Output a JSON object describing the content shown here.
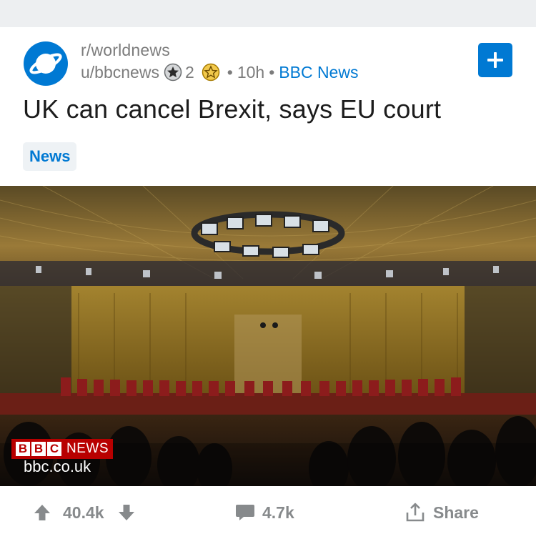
{
  "post": {
    "subreddit": "r/worldnews",
    "author": "u/bbcnews",
    "award_count": "2",
    "age": "10h",
    "source": "BBC News",
    "separator": "•",
    "title": "UK can cancel Brexit, says EU court",
    "flair": "News"
  },
  "media": {
    "overlay_brand": "NEWS",
    "overlay_brand_boxes": [
      "B",
      "B",
      "C"
    ],
    "domain": "bbc.co.uk"
  },
  "actions": {
    "upvotes": "40.4k",
    "comments": "4.7k",
    "share_label": "Share"
  },
  "colors": {
    "accent": "#0079d3",
    "icon_gray": "#878a8c",
    "text_gray": "#7c7c7c",
    "bbc_red": "#b80000"
  },
  "icons": {
    "subreddit": "planet-icon",
    "award_silver": "silver-award-icon",
    "award_gold": "gold-award-icon",
    "add": "plus-icon",
    "upvote": "upvote-arrow-icon",
    "downvote": "downvote-arrow-icon",
    "comment": "comment-bubble-icon",
    "share": "share-icon"
  }
}
